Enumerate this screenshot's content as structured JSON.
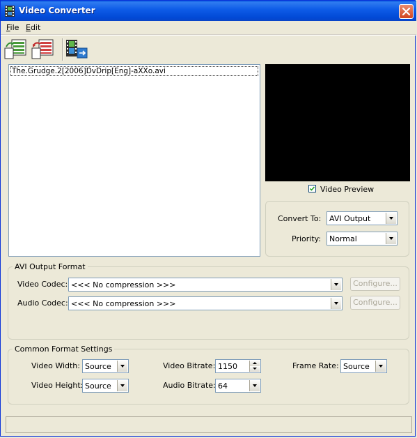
{
  "window": {
    "title": "Video Converter"
  },
  "menu": {
    "file": "File",
    "edit": "Edit"
  },
  "toolbar": {
    "icons": [
      "add-file-icon",
      "remove-file-icon",
      "convert-icon"
    ]
  },
  "files": [
    "The.Grudge.2[2006]DvDrip[Eng]-aXXo.avi"
  ],
  "preview": {
    "label": "Video Preview",
    "checked": true
  },
  "convert": {
    "convert_to_label": "Convert To:",
    "convert_to_value": "AVI Output",
    "priority_label": "Priority:",
    "priority_value": "Normal"
  },
  "avi_output": {
    "title": "AVI Output Format",
    "video_codec_label": "Video Codec:",
    "video_codec_value": "<<< No compression >>>",
    "audio_codec_label": "Audio Codec:",
    "audio_codec_value": "<<< No compression >>>",
    "configure_label": "Configure..."
  },
  "common": {
    "title": "Common Format Settings",
    "video_width_label": "Video Width:",
    "video_width_value": "Source",
    "video_height_label": "Video Height:",
    "video_height_value": "Source",
    "video_bitrate_label": "Video Bitrate:",
    "video_bitrate_value": "1150",
    "audio_bitrate_label": "Audio Bitrate:",
    "audio_bitrate_value": "64",
    "frame_rate_label": "Frame Rate:",
    "frame_rate_value": "Source"
  },
  "colors": {
    "titlebar": "#0149D6",
    "face": "#ECE9D8",
    "preview_bg": "#000000"
  }
}
